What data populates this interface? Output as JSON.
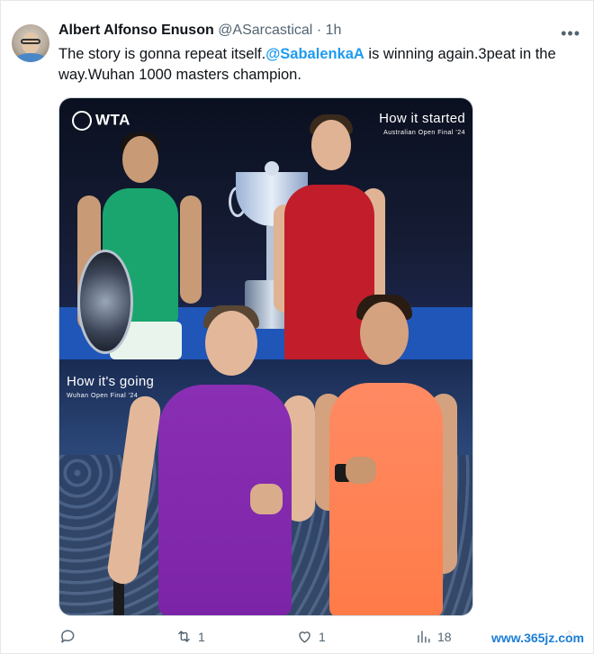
{
  "author": {
    "name": "Albert Alfonso Enuson",
    "handle": "@ASarcastical",
    "separator": "·",
    "time": "1h"
  },
  "tweet": {
    "text_before": "The story is gonna repeat itself.",
    "mention": "@SabalenkaA",
    "text_after": " is winning again.3peat in the way.Wuhan 1000 masters champion."
  },
  "media": {
    "brand": "WTA",
    "top_caption": "How it started",
    "top_subcaption": "Australian Open Final '24",
    "bottom_caption": "How it's going",
    "bottom_subcaption": "Wuhan Open Final '24"
  },
  "actions": {
    "replies": "",
    "retweets": "1",
    "likes": "1",
    "views": "18"
  },
  "icons": {
    "more": "more-icon",
    "reply": "reply-icon",
    "retweet": "retweet-icon",
    "like": "heart-icon",
    "views": "views-icon",
    "share": "share-icon"
  },
  "watermark": "www.365jz.com",
  "colors": {
    "mention": "#1d9bf0",
    "muted": "#536471",
    "text": "#0f1419"
  }
}
